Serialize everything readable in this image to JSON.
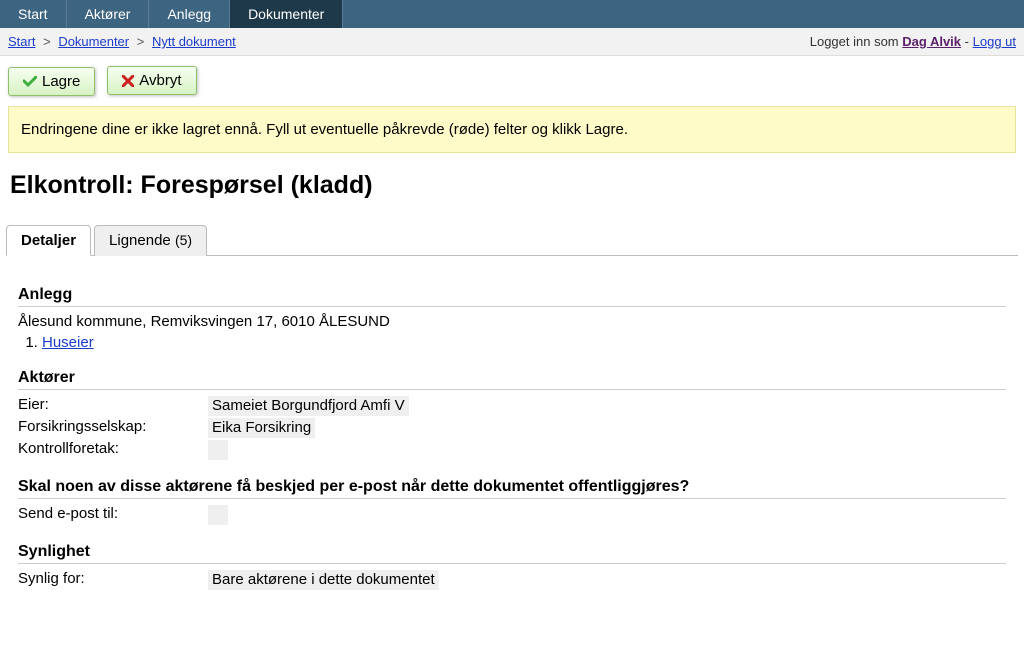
{
  "nav": {
    "items": [
      {
        "label": "Start"
      },
      {
        "label": "Aktører"
      },
      {
        "label": "Anlegg"
      },
      {
        "label": "Dokumenter"
      }
    ],
    "active_index": 3
  },
  "breadcrumb": {
    "items": [
      "Start",
      "Dokumenter",
      "Nytt dokument"
    ],
    "sep": ">"
  },
  "login": {
    "prefix": "Logget inn som",
    "user": "Dag Alvik",
    "sep": "-",
    "logout": "Logg ut"
  },
  "toolbar": {
    "save_label": "Lagre",
    "cancel_label": "Avbryt"
  },
  "notice": {
    "text": "Endringene dine er ikke lagret ennå. Fyll ut eventuelle påkrevde (røde) felter og klikk Lagre."
  },
  "page_title": "Elkontroll: Forespørsel (kladd)",
  "tabs": {
    "items": [
      {
        "label": "Detaljer",
        "count": ""
      },
      {
        "label": "Lignende",
        "count": "(5)"
      }
    ],
    "active_index": 0
  },
  "sections": {
    "anlegg": {
      "heading": "Anlegg",
      "address": "Ålesund kommune, Remviksvingen 17, 6010 ÅLESUND",
      "links": [
        "Huseier"
      ]
    },
    "aktorer": {
      "heading": "Aktører",
      "rows": [
        {
          "label": "Eier:",
          "value": "Sameiet Borgundfjord Amfi V"
        },
        {
          "label": "Forsikringsselskap:",
          "value": "Eika Forsikring"
        },
        {
          "label": "Kontrollforetak:",
          "value": ""
        }
      ]
    },
    "epost": {
      "heading": "Skal noen av disse aktørene få beskjed per e-post når dette dokumentet offentliggjøres?",
      "rows": [
        {
          "label": "Send e-post til:",
          "value": ""
        }
      ]
    },
    "synlighet": {
      "heading": "Synlighet",
      "rows": [
        {
          "label": "Synlig for:",
          "value": "Bare aktørene i dette dokumentet"
        }
      ]
    }
  }
}
